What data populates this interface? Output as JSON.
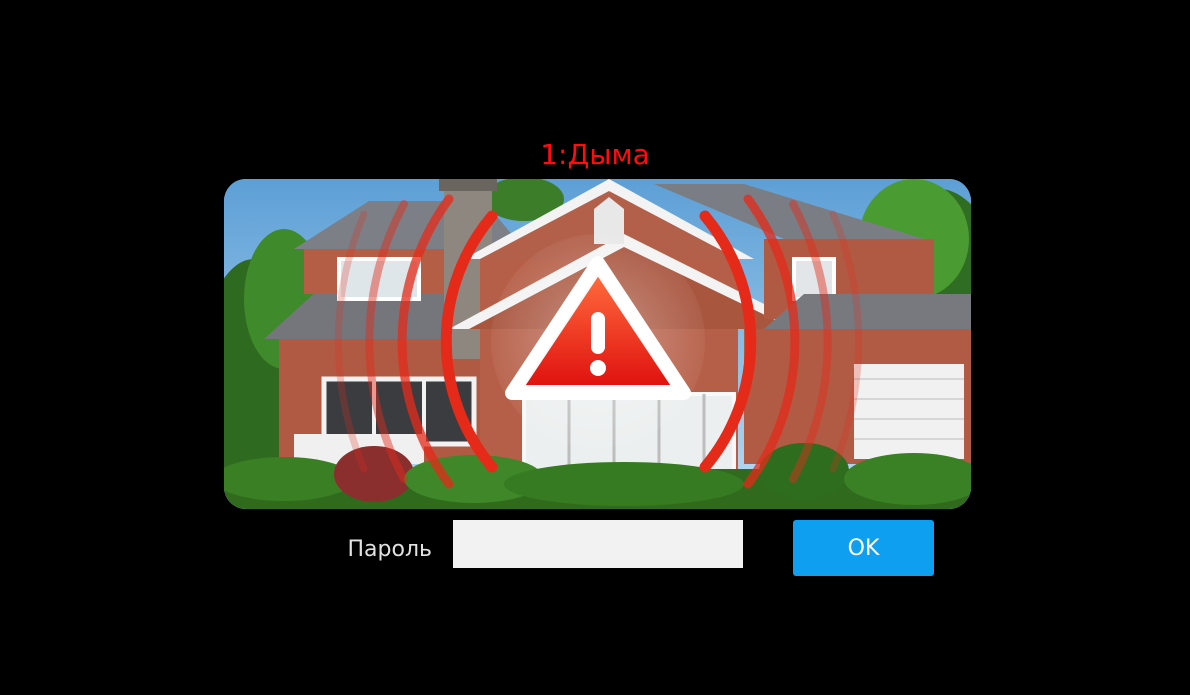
{
  "alarm": {
    "title": "1:Дыма",
    "title_color": "#ff0d0d",
    "image": "house-with-alarm-warning",
    "icon": "warning-triangle-icon"
  },
  "password": {
    "label": "Пароль",
    "value": "",
    "placeholder": ""
  },
  "ok_button": {
    "label": "OK",
    "color": "#0f9ff0"
  }
}
